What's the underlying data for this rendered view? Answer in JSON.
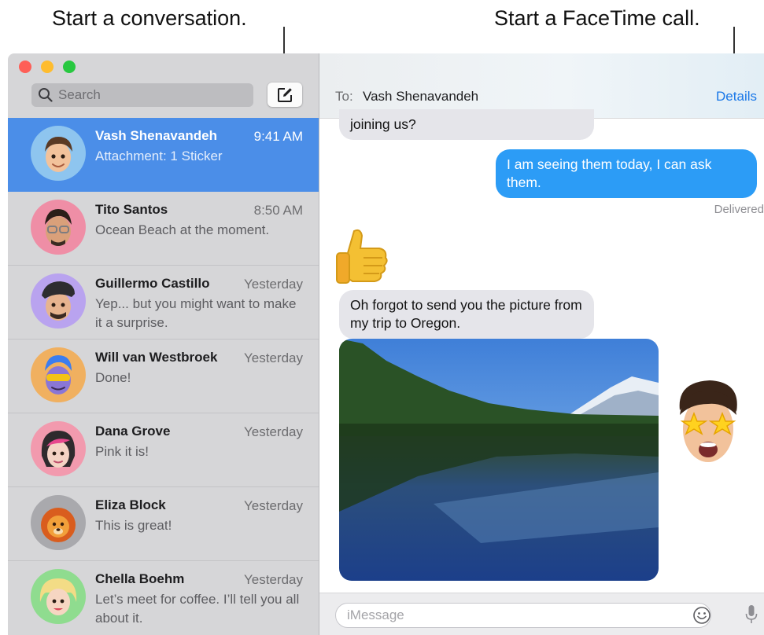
{
  "callouts": {
    "compose": "Start a conversation.",
    "facetime": "Start a FaceTime call."
  },
  "colors": {
    "selection": "#4b8ee8",
    "sent_bubble": "#2c9cf6",
    "received_bubble": "#e5e5ea",
    "link": "#1877e8"
  },
  "sidebar": {
    "search_placeholder": "Search",
    "compose_icon": "compose-icon",
    "conversations": [
      {
        "name": "Vash Shenavandeh",
        "time": "9:41 AM",
        "preview": "Attachment: 1 Sticker",
        "avatar_color": "#8ec5ef",
        "selected": true
      },
      {
        "name": "Tito Santos",
        "time": "8:50 AM",
        "preview": "Ocean Beach at the moment.",
        "avatar_color": "#ef8ea6"
      },
      {
        "name": "Guillermo Castillo",
        "time": "Yesterday",
        "preview": "Yep... but you might want to make it a surprise.",
        "avatar_color": "#b9a3ef"
      },
      {
        "name": "Will van Westbroek",
        "time": "Yesterday",
        "preview": "Done!",
        "avatar_color": "#f0b060"
      },
      {
        "name": "Dana Grove",
        "time": "Yesterday",
        "preview": "Pink it is!",
        "avatar_color": "#f29aae"
      },
      {
        "name": "Eliza Block",
        "time": "Yesterday",
        "preview": "This is great!",
        "avatar_color": "#a9a9ad"
      },
      {
        "name": "Chella Boehm",
        "time": "Yesterday",
        "preview": "Let’s meet for coffee. I’ll tell you all about it.",
        "avatar_color": "#8fdc8f"
      }
    ]
  },
  "chat": {
    "to_label": "To:",
    "recipient": "Vash Shenavandeh",
    "details_label": "Details",
    "messages": [
      {
        "text": "joining us?",
        "direction": "received"
      },
      {
        "text": "I am seeing them today, I can ask them.",
        "direction": "sent"
      },
      {
        "text": "Oh forgot to send you the picture from my trip to Oregon.",
        "direction": "received"
      }
    ],
    "status": "Delivered",
    "composer_placeholder": "iMessage",
    "emoji_icon": "emoji-icon",
    "mic_icon": "microphone-icon"
  }
}
